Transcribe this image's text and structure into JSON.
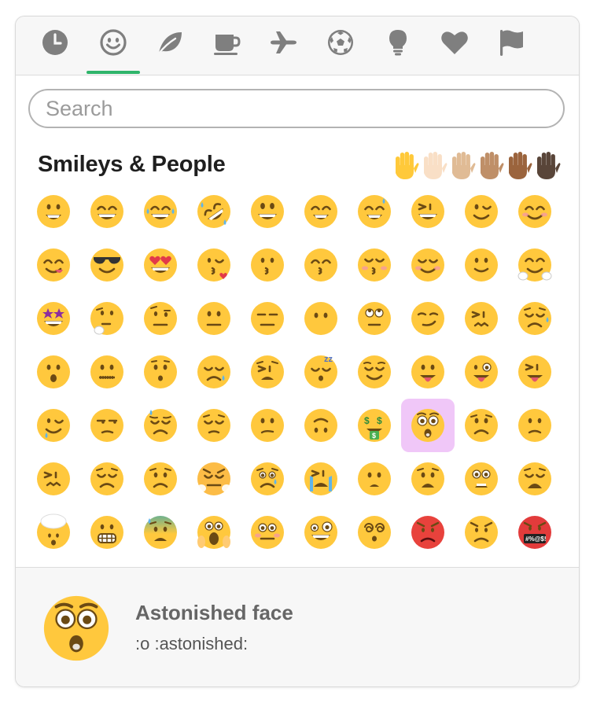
{
  "tabs": [
    {
      "id": "recent",
      "icon": "clock-icon",
      "active": false
    },
    {
      "id": "people",
      "icon": "smiley-icon",
      "active": true
    },
    {
      "id": "nature",
      "icon": "leaf-icon",
      "active": false
    },
    {
      "id": "food",
      "icon": "coffee-cup-icon",
      "active": false
    },
    {
      "id": "travel",
      "icon": "airplane-icon",
      "active": false
    },
    {
      "id": "activity",
      "icon": "soccer-ball-icon",
      "active": false
    },
    {
      "id": "objects",
      "icon": "lightbulb-icon",
      "active": false
    },
    {
      "id": "symbols",
      "icon": "heart-icon",
      "active": false
    },
    {
      "id": "flags",
      "icon": "flag-icon",
      "active": false
    }
  ],
  "search": {
    "placeholder": "Search",
    "value": ""
  },
  "category": {
    "title": "Smileys & People"
  },
  "skin_tones": [
    "#ffc93a",
    "#f9dfc6",
    "#e0bb95",
    "#bf8f68",
    "#9b643d",
    "#594539"
  ],
  "emojis": [
    "grinning",
    "grin",
    "joy",
    "rofl",
    "smiley",
    "smile",
    "sweat-smile",
    "laughing",
    "wink",
    "blush",
    "yum",
    "sunglasses",
    "heart-eyes",
    "kissing-heart",
    "kissing",
    "kissing-smiling-eyes",
    "kissing-closed-eyes",
    "relaxed",
    "slightly-smiling",
    "hugging",
    "star-struck",
    "thinking",
    "raised-eyebrow",
    "neutral",
    "expressionless",
    "no-mouth",
    "roll-eyes",
    "smirk",
    "persevere",
    "disappointed-relieved",
    "open-mouth",
    "zipper-mouth",
    "hushed",
    "sleepy",
    "tired",
    "sleeping",
    "relieved",
    "stuck-out-tongue",
    "stuck-out-tongue-winking",
    "stuck-out-tongue-closed-eyes",
    "drooling",
    "unamused",
    "sweat",
    "pensive",
    "confused",
    "upside-down",
    "money-mouth",
    "astonished",
    "frowning2",
    "slightly-frowning",
    "confounded",
    "disappointed",
    "worried",
    "triumph",
    "cry",
    "sob",
    "frowning",
    "anguished",
    "fearful",
    "weary",
    "exploding-head",
    "grimacing",
    "cold-sweat",
    "scream",
    "flushed",
    "zany",
    "dizzy",
    "rage",
    "angry",
    "cursing"
  ],
  "selected_index": 47,
  "preview": {
    "emoji": "astonished",
    "name": "Astonished face",
    "shortcodes": ":o :astonished:"
  },
  "colors": {
    "accent": "#2fb56b",
    "tab_icon": "#7f7f7f",
    "face": "#ffc83d",
    "face_dark": "#e8a926",
    "selected_bg": "#f0c7f8"
  }
}
